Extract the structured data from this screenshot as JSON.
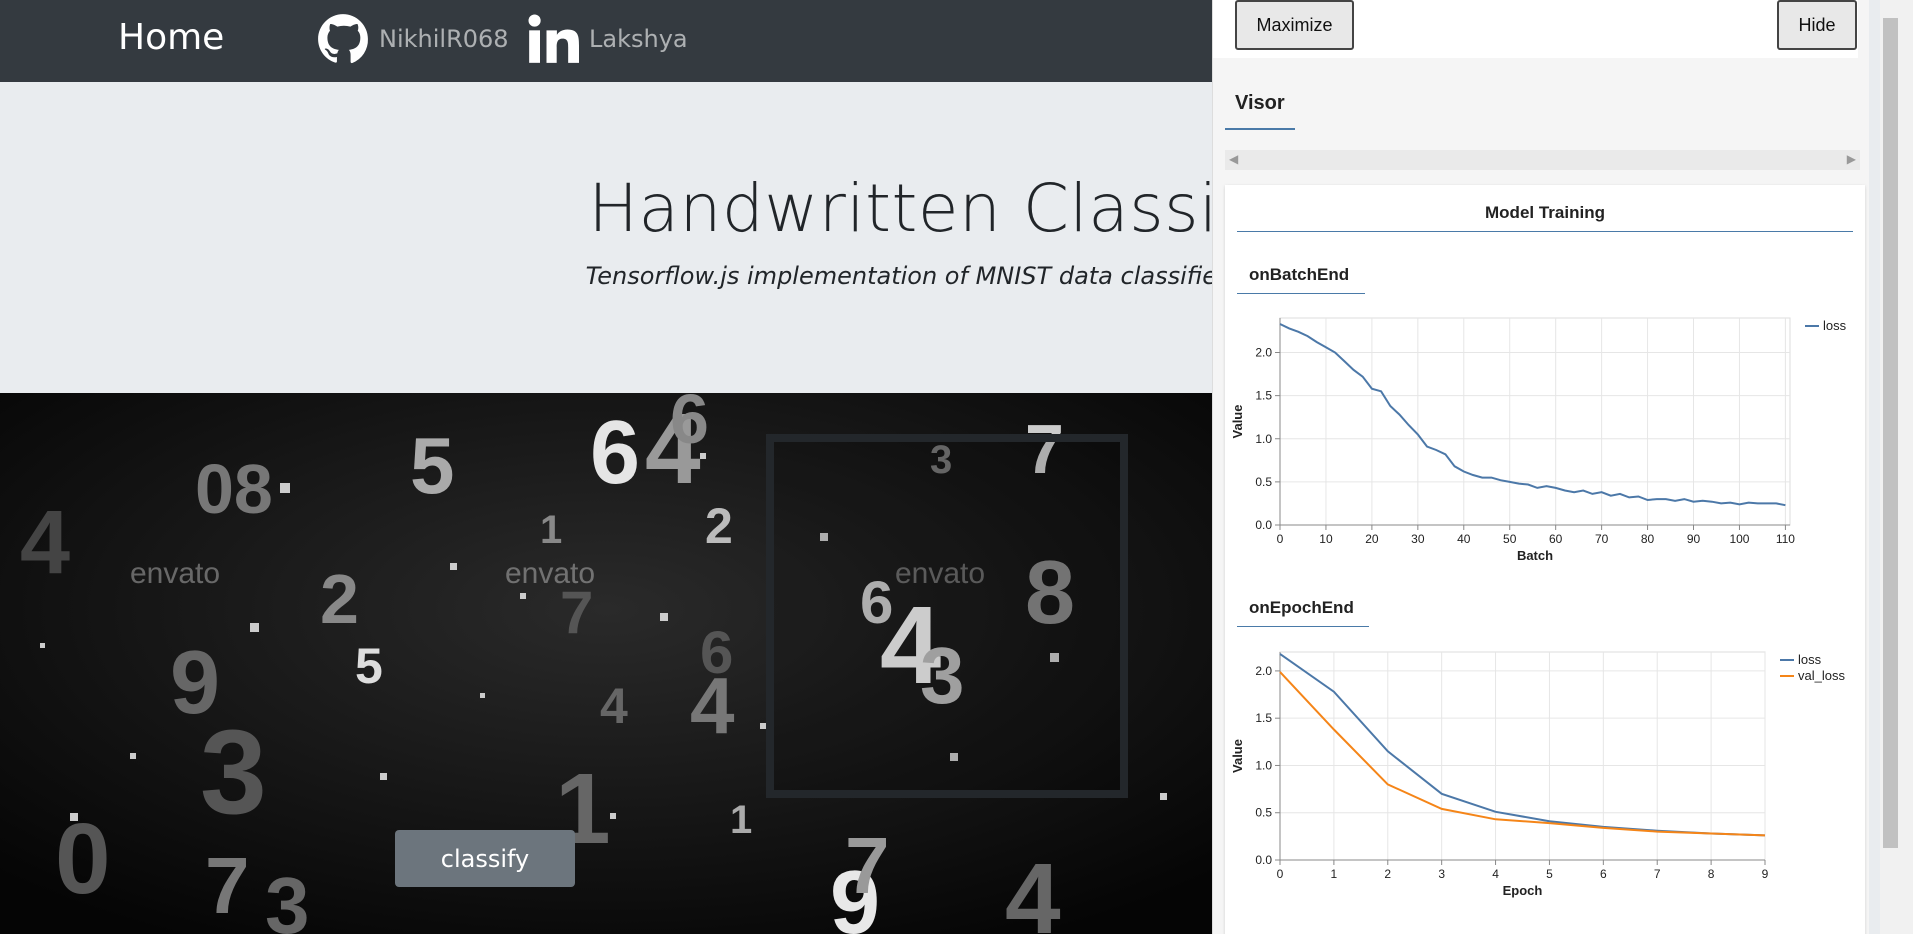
{
  "nav": {
    "home": "Home",
    "github": "NikhilR068",
    "linkedin": "Lakshya"
  },
  "hero": {
    "title": "Handwritten Classif",
    "subtitle": "Tensorflow.js implementation of MNIST data classifier r"
  },
  "stage": {
    "classify_label": "classify",
    "watermark": "envato"
  },
  "visor": {
    "maximize_label": "Maximize",
    "hide_label": "Hide",
    "tab_label": "Visor",
    "surface_title": "Model Training",
    "batch_section": "onBatchEnd",
    "epoch_section": "onEpochEnd",
    "colors": {
      "loss": "#4c78a8",
      "val_loss": "#f58518",
      "accent": "#4a7aa8"
    }
  },
  "chart_data": [
    {
      "type": "line",
      "title": "onBatchEnd",
      "xlabel": "Batch",
      "ylabel": "Value",
      "xlim": [
        0,
        111
      ],
      "ylim": [
        0,
        2.4
      ],
      "xticks": [
        0,
        10,
        20,
        30,
        40,
        50,
        60,
        70,
        80,
        90,
        100,
        110
      ],
      "yticks": [
        0.0,
        0.5,
        1.0,
        1.5,
        2.0
      ],
      "grid": true,
      "legend": "top-right",
      "series": [
        {
          "name": "loss",
          "x": [
            0,
            2,
            4,
            6,
            8,
            10,
            12,
            14,
            16,
            18,
            20,
            22,
            24,
            26,
            28,
            30,
            32,
            34,
            36,
            38,
            40,
            42,
            44,
            46,
            48,
            50,
            52,
            54,
            56,
            58,
            60,
            62,
            64,
            66,
            68,
            70,
            72,
            74,
            76,
            78,
            80,
            82,
            84,
            86,
            88,
            90,
            92,
            94,
            96,
            98,
            100,
            102,
            104,
            106,
            108,
            110
          ],
          "values": [
            2.33,
            2.28,
            2.24,
            2.19,
            2.12,
            2.06,
            2.0,
            1.9,
            1.8,
            1.72,
            1.58,
            1.55,
            1.38,
            1.28,
            1.16,
            1.05,
            0.91,
            0.87,
            0.82,
            0.68,
            0.62,
            0.58,
            0.55,
            0.55,
            0.52,
            0.5,
            0.48,
            0.47,
            0.43,
            0.45,
            0.43,
            0.4,
            0.38,
            0.4,
            0.36,
            0.38,
            0.34,
            0.36,
            0.32,
            0.33,
            0.29,
            0.3,
            0.3,
            0.28,
            0.3,
            0.27,
            0.28,
            0.27,
            0.25,
            0.26,
            0.24,
            0.26,
            0.25,
            0.25,
            0.25,
            0.23
          ]
        }
      ]
    },
    {
      "type": "line",
      "title": "onEpochEnd",
      "xlabel": "Epoch",
      "ylabel": "Value",
      "xlim": [
        0,
        9
      ],
      "ylim": [
        0,
        2.2
      ],
      "xticks": [
        0,
        1,
        2,
        3,
        4,
        5,
        6,
        7,
        8,
        9
      ],
      "yticks": [
        0.0,
        0.5,
        1.0,
        1.5,
        2.0
      ],
      "grid": true,
      "legend": "top-right",
      "series": [
        {
          "name": "loss",
          "x": [
            0,
            1,
            2,
            3,
            4,
            5,
            6,
            7,
            8,
            9
          ],
          "values": [
            2.18,
            1.78,
            1.15,
            0.7,
            0.51,
            0.41,
            0.35,
            0.31,
            0.28,
            0.26
          ]
        },
        {
          "name": "val_loss",
          "x": [
            0,
            1,
            2,
            3,
            4,
            5,
            6,
            7,
            8,
            9
          ],
          "values": [
            1.99,
            1.38,
            0.8,
            0.54,
            0.43,
            0.39,
            0.34,
            0.3,
            0.28,
            0.26
          ]
        }
      ]
    }
  ]
}
